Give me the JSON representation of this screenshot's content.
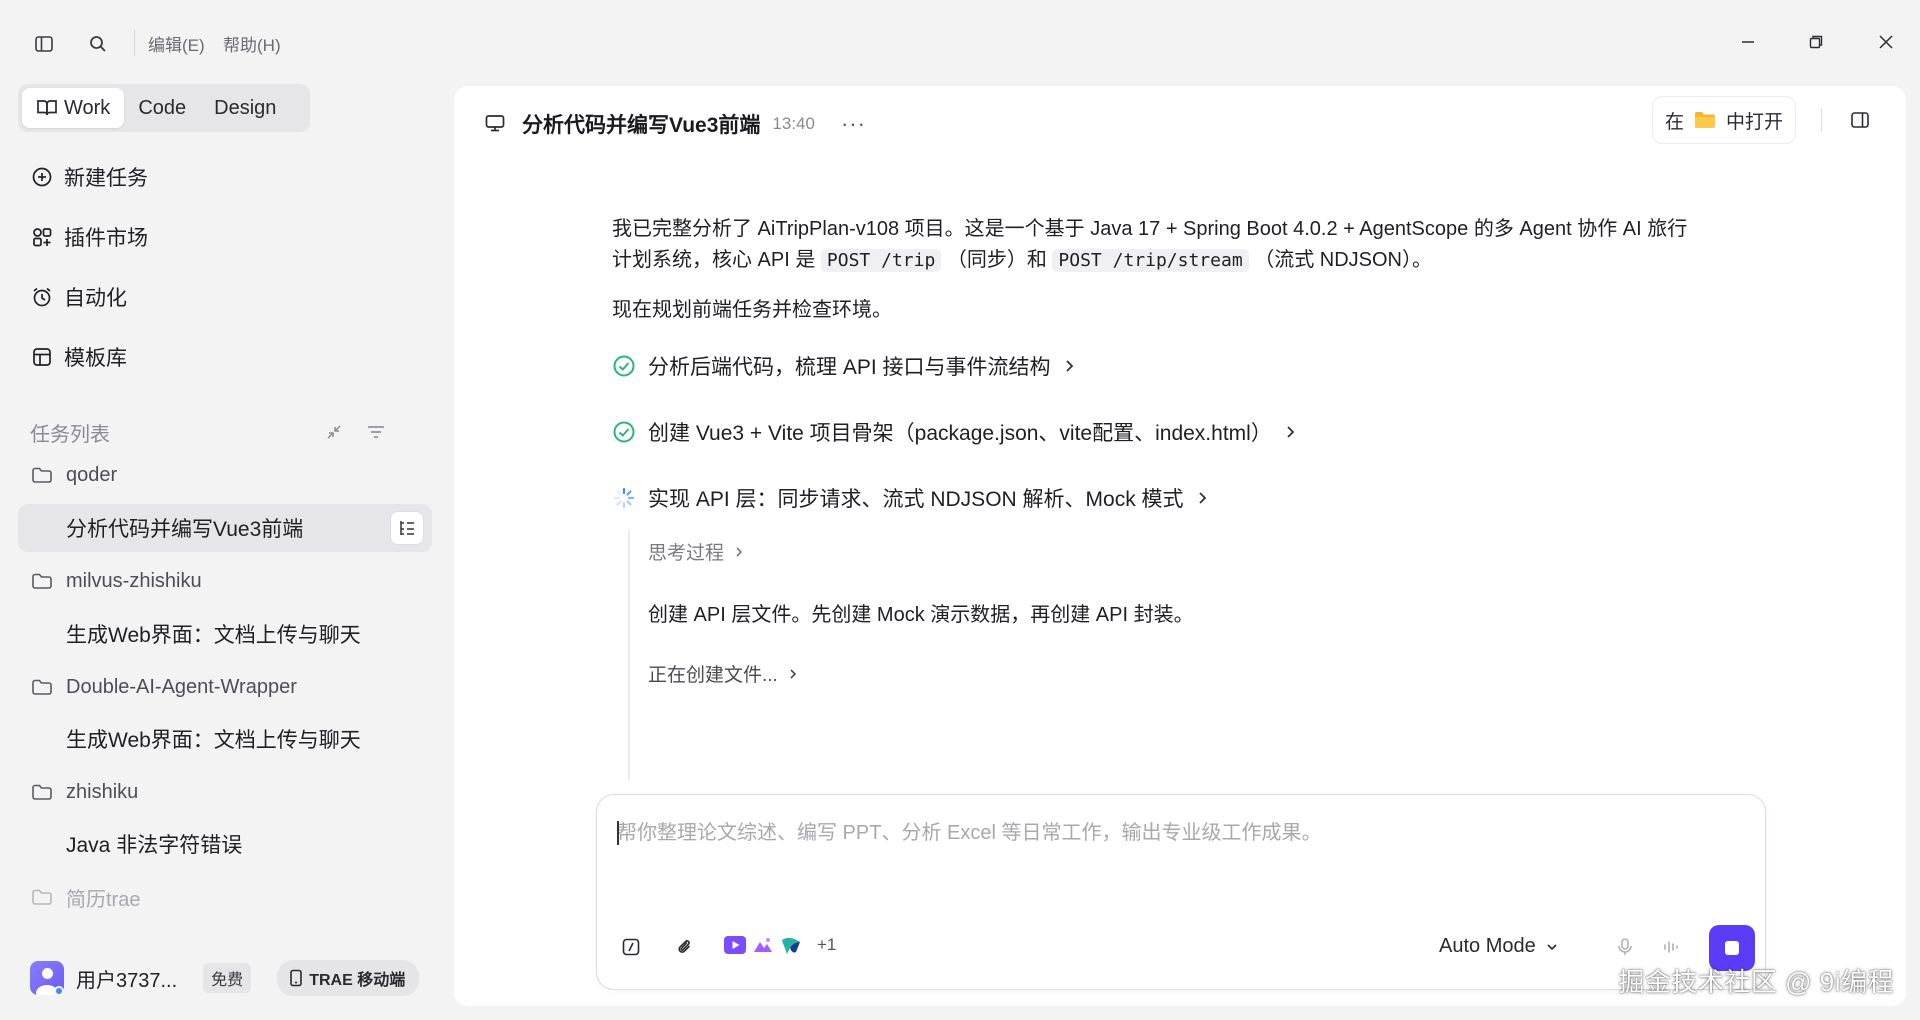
{
  "menu": {
    "edit": "编辑(E)",
    "help": "帮助(H)"
  },
  "modes": {
    "work": "Work",
    "code": "Code",
    "design": "Design"
  },
  "nav": [
    {
      "label": "新建任务",
      "icon": "plus-circle-icon"
    },
    {
      "label": "插件市场",
      "icon": "plugin-grid-icon"
    },
    {
      "label": "自动化",
      "icon": "alarm-clock-icon"
    },
    {
      "label": "模板库",
      "icon": "template-icon"
    }
  ],
  "tasks": {
    "header": "任务列表",
    "groups": [
      {
        "folder": "qoder",
        "items": [
          "分析代码并编写Vue3前端"
        ]
      },
      {
        "folder": "milvus-zhishiku",
        "items": [
          "生成Web界面：文档上传与聊天"
        ]
      },
      {
        "folder": "Double-AI-Agent-Wrapper",
        "items": [
          "生成Web界面：文档上传与聊天"
        ]
      },
      {
        "folder": "zhishiku",
        "items": [
          "Java 非法字符错误"
        ]
      },
      {
        "folder": "简历trae",
        "items": []
      }
    ]
  },
  "user": {
    "name": "用户3737...",
    "badge": "免费",
    "mobile": "TRAE 移动端"
  },
  "chat": {
    "title": "分析代码并编写Vue3前端",
    "time": "13:40",
    "more": "···",
    "open_in": {
      "prefix": "在",
      "suffix": "中打开"
    },
    "msg1_a": "我已完整分析了 AiTripPlan-v108 项目。这是一个基于 Java 17 + Spring Boot 4.0.2 + AgentScope 的多 Agent 协作 AI 旅行",
    "msg1_b": "计划系统，核心 API 是",
    "msg1_code1": "POST /trip",
    "msg1_c": "（同步）和",
    "msg1_code2": "POST /trip/stream",
    "msg1_d": "（流式 NDJSON）。",
    "msg2": "现在规划前端任务并检查环境。",
    "steps": [
      {
        "label": "分析后端代码，梳理 API 接口与事件流结构",
        "status": "done"
      },
      {
        "label": "创建 Vue3 + Vite 项目骨架（package.json、vite配置、index.html）",
        "status": "done"
      },
      {
        "label": "实现 API 层：同步请求、流式 NDJSON 解析、Mock 模式",
        "status": "in-progress"
      }
    ],
    "thinking": "思考过程",
    "sub_text": "创建 API 层文件。先创建 Mock 演示数据，再创建 API 封装。",
    "creating": "正在创建文件..."
  },
  "input": {
    "placeholder": "帮你整理论文综述、编写 PPT、分析 Excel 等日常工作，输出专业级工作成果。",
    "value": "",
    "plugins_more": "+1",
    "mode": "Auto Mode"
  },
  "watermark": "掘金技术社区 @ 9i编程",
  "colors": {
    "accent": "#5b3bf5",
    "success": "#2bb673",
    "folder": "#f5b731"
  }
}
